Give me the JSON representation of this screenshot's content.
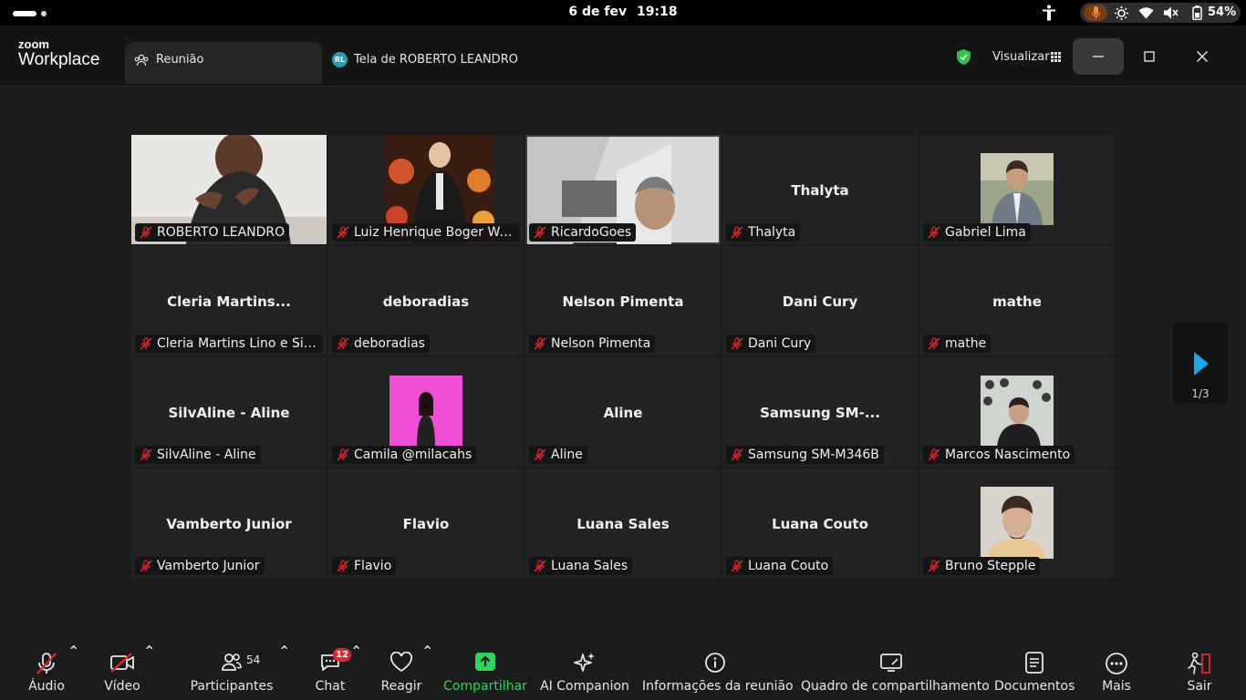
{
  "os": {
    "date": "6 de fev",
    "time": "19:18",
    "battery": "54%"
  },
  "app": {
    "logo_top": "zoom",
    "logo_bottom": "Workplace"
  },
  "tabs": [
    {
      "label": "Reunião",
      "active": true
    },
    {
      "label": "Tela de ROBERTO LEANDRO",
      "badge": "RL",
      "active": false
    }
  ],
  "header": {
    "view_label": "Visualizar"
  },
  "tiles": [
    {
      "name": "ROBERTO LEANDRO",
      "display": "",
      "video": true,
      "speaker": true
    },
    {
      "name": "Luiz Henrique Boger We...",
      "display": "",
      "video": true
    },
    {
      "name": "RicardoGoes",
      "display": "",
      "video": true
    },
    {
      "name": "Thalyta",
      "display": "Thalyta"
    },
    {
      "name": "Gabriel Lima",
      "display": "",
      "photo": true
    },
    {
      "name": "Cleria Martins Lino e Silva",
      "display": "Cleria Martins..."
    },
    {
      "name": "deboradias",
      "display": "deboradias"
    },
    {
      "name": "Nelson Pimenta",
      "display": "Nelson Pimenta"
    },
    {
      "name": "Dani Cury",
      "display": "Dani Cury"
    },
    {
      "name": "mathe",
      "display": "mathe"
    },
    {
      "name": "SilvAline - Aline",
      "display": "SilvAline - Aline"
    },
    {
      "name": "Camila @milacahs",
      "display": "",
      "photo": true
    },
    {
      "name": "Aline",
      "display": "Aline"
    },
    {
      "name": "Samsung SM-M346B",
      "display": "Samsung SM-..."
    },
    {
      "name": "Marcos Nascimento",
      "display": "",
      "photo": true
    },
    {
      "name": "Vamberto Junior",
      "display": "Vamberto Junior"
    },
    {
      "name": "Flavio",
      "display": "Flavio"
    },
    {
      "name": "Luana Sales",
      "display": "Luana Sales"
    },
    {
      "name": "Luana Couto",
      "display": "Luana Couto"
    },
    {
      "name": "Bruno Stepple",
      "display": "",
      "photo": true
    }
  ],
  "pager": {
    "label": "1/3"
  },
  "toolbar": {
    "audio": "Áudio",
    "video": "Vídeo",
    "participants": "Participantes",
    "participants_count": "54",
    "chat": "Chat",
    "chat_badge": "12",
    "react": "Reagir",
    "share": "Compartilhar",
    "ai": "AI Companion",
    "info": "Informações da reunião",
    "whiteboard": "Quadro de compartilhamento",
    "docs": "Documentos",
    "more": "Mais",
    "leave": "Sair"
  },
  "colors": {
    "speaker_border": "#4dd35a",
    "share_green": "#2fd35e",
    "mute_red": "#e0282e",
    "pager_arrow": "#1aa7e8"
  }
}
